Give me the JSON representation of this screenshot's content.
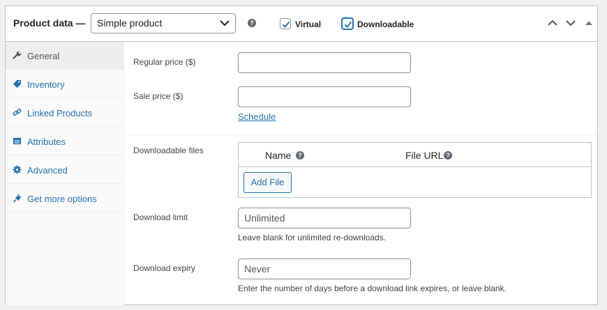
{
  "header": {
    "title": "Product data —",
    "product_type": "Simple product",
    "virtual_label": "Virtual",
    "virtual_checked": true,
    "downloadable_label": "Downloadable",
    "downloadable_checked": true
  },
  "tabs": [
    {
      "label": "General",
      "icon": "wrench-icon",
      "active": true
    },
    {
      "label": "Inventory",
      "icon": "tag-icon",
      "active": false
    },
    {
      "label": "Linked Products",
      "icon": "link-icon",
      "active": false
    },
    {
      "label": "Attributes",
      "icon": "table-icon",
      "active": false
    },
    {
      "label": "Advanced",
      "icon": "gear-icon",
      "active": false
    },
    {
      "label": "Get more options",
      "icon": "plugin-icon",
      "active": false
    }
  ],
  "general": {
    "regular_price_label": "Regular price ($)",
    "regular_price_value": "",
    "sale_price_label": "Sale price ($)",
    "sale_price_value": "",
    "schedule_link": "Schedule",
    "downloadable_files_label": "Downloadable files",
    "files_col_name": "Name",
    "files_col_url": "File URL",
    "add_file_button": "Add File",
    "download_limit_label": "Download limit",
    "download_limit_placeholder": "Unlimited",
    "download_limit_desc": "Leave blank for unlimited re-downloads.",
    "download_expiry_label": "Download expiry",
    "download_expiry_placeholder": "Never",
    "download_expiry_desc": "Enter the number of days before a download link expires, or leave blank."
  },
  "colors": {
    "link": "#2271b1",
    "border": "#c3c4c7",
    "text": "#1d2327"
  }
}
